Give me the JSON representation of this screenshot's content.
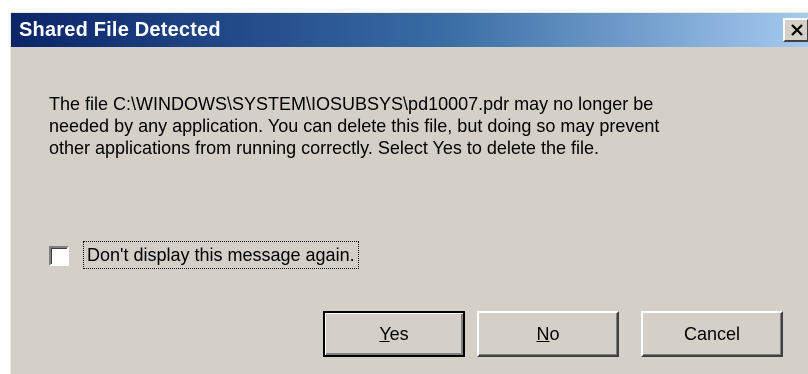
{
  "window": {
    "title": "Shared File Detected"
  },
  "title_bar": {
    "close_icon": "close-x-icon"
  },
  "message": {
    "lines": [
      "The file C:\\WINDOWS\\SYSTEM\\IOSUBSYS\\pd10007.pdr may no longer be",
      "needed by any application. You can delete this file, but doing so may prevent",
      "other applications from running correctly.  Select Yes to delete the file."
    ]
  },
  "checkbox": {
    "label": "Don't display this message again.",
    "checked": false
  },
  "buttons": {
    "yes": {
      "mnemonic": "Y",
      "rest": "es"
    },
    "no": {
      "mnemonic": "N",
      "rest": "o"
    },
    "cancel": {
      "label": "Cancel"
    }
  },
  "colors": {
    "titlebar_start": "#0a246a",
    "titlebar_end": "#a6caf0",
    "dialog_face": "#d4d0c8"
  }
}
